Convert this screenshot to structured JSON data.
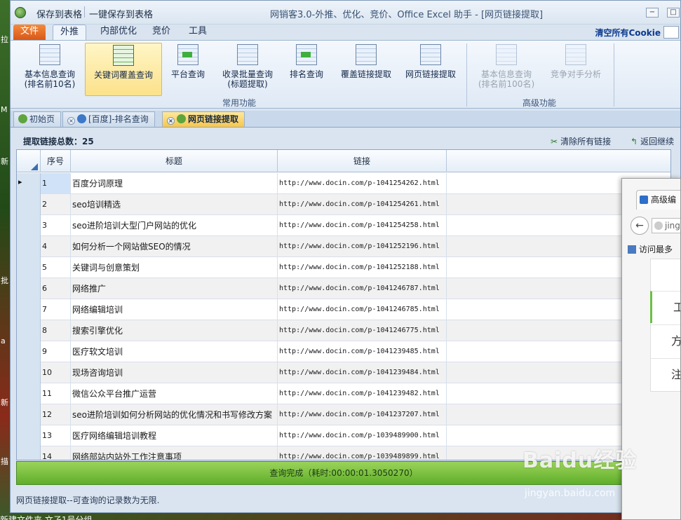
{
  "desktop": {
    "side_glyphs": [
      "拉",
      "M",
      "新",
      "批",
      "a",
      "新",
      "描"
    ],
    "taskbar_text": "新建文件夹    文孑1号分组"
  },
  "window": {
    "quick_access": [
      "保存到表格",
      "一键保存到表格"
    ],
    "title": "网销客3.0-外推、优化、竞价、Office Excel 助手 - [网页链接提取]",
    "controls": [
      "−",
      "□"
    ]
  },
  "ribbon_tabs": [
    "文件",
    "外推",
    "内部优化",
    "竞价",
    "工具"
  ],
  "clear_cookie": "清空所有Cookie",
  "ribbon": {
    "common": {
      "label": "常用功能",
      "buttons": [
        {
          "label": "基本信息查询\n(排名前10名)",
          "icon": "table-icon"
        },
        {
          "label": "关键词覆盖查询",
          "icon": "keyword-table-icon"
        },
        {
          "label": "平台查询",
          "icon": "platform-icon"
        },
        {
          "label": "收录批量查询\n(标题提取)",
          "icon": "batch-index-icon"
        },
        {
          "label": "排名查询",
          "icon": "rank-icon"
        },
        {
          "label": "覆盖链接提取",
          "icon": "cover-link-icon"
        },
        {
          "label": "网页链接提取",
          "icon": "page-link-icon"
        }
      ]
    },
    "advanced": {
      "label": "高级功能",
      "buttons": [
        {
          "label": "基本信息查询\n(排名前100名)",
          "icon": "table-icon"
        },
        {
          "label": "竞争对手分析",
          "icon": "competitor-icon"
        }
      ]
    }
  },
  "doc_tabs": [
    "初始页",
    "[百度]-排名查询",
    "网页链接提取"
  ],
  "info": {
    "count_label": "提取链接总数：25",
    "clear_links": "清除所有链接",
    "back_continue": "返回继续"
  },
  "grid": {
    "headers": [
      "序号",
      "标题",
      "链接"
    ],
    "rows": [
      {
        "n": "1",
        "title": "百度分词原理",
        "link": "http://www.docin.com/p-1041254262.html"
      },
      {
        "n": "2",
        "title": "seo培训精选",
        "link": "http://www.docin.com/p-1041254261.html"
      },
      {
        "n": "3",
        "title": "seo进阶培训大型门户网站的优化",
        "link": "http://www.docin.com/p-1041254258.html"
      },
      {
        "n": "4",
        "title": "如何分析一个网站做SEO的情况",
        "link": "http://www.docin.com/p-1041252196.html"
      },
      {
        "n": "5",
        "title": "关键词与创意策划",
        "link": "http://www.docin.com/p-1041252188.html"
      },
      {
        "n": "6",
        "title": "网络推广",
        "link": "http://www.docin.com/p-1041246787.html"
      },
      {
        "n": "7",
        "title": "网络编辑培训",
        "link": "http://www.docin.com/p-1041246785.html"
      },
      {
        "n": "8",
        "title": "搜索引擎优化",
        "link": "http://www.docin.com/p-1041246775.html"
      },
      {
        "n": "9",
        "title": "医疗软文培训",
        "link": "http://www.docin.com/p-1041239485.html"
      },
      {
        "n": "10",
        "title": "现场咨询培训",
        "link": "http://www.docin.com/p-1041239484.html"
      },
      {
        "n": "11",
        "title": "微信公众平台推广运营",
        "link": "http://www.docin.com/p-1041239482.html"
      },
      {
        "n": "12",
        "title": "seo进阶培训如何分析网站的优化情况和书写修改方案",
        "link": "http://www.docin.com/p-1041237207.html"
      },
      {
        "n": "13",
        "title": "医疗网络编辑培训教程",
        "link": "http://www.docin.com/p-1039489900.html"
      },
      {
        "n": "14",
        "title": "网络部站内站外工作注意事项",
        "link": "http://www.docin.com/p-1039489899.html"
      }
    ]
  },
  "status": "查询完成（耗时:00:00:01.3050270）",
  "footer": "网页链接提取--可查询的记录数为无限.",
  "browser": {
    "tab": "高级编",
    "url": "jing",
    "favorites": "访问最多",
    "items": [
      "工",
      "方",
      "注"
    ]
  },
  "watermark": {
    "main": "Baidu经验",
    "sub": "jingyan.baidu.com"
  }
}
